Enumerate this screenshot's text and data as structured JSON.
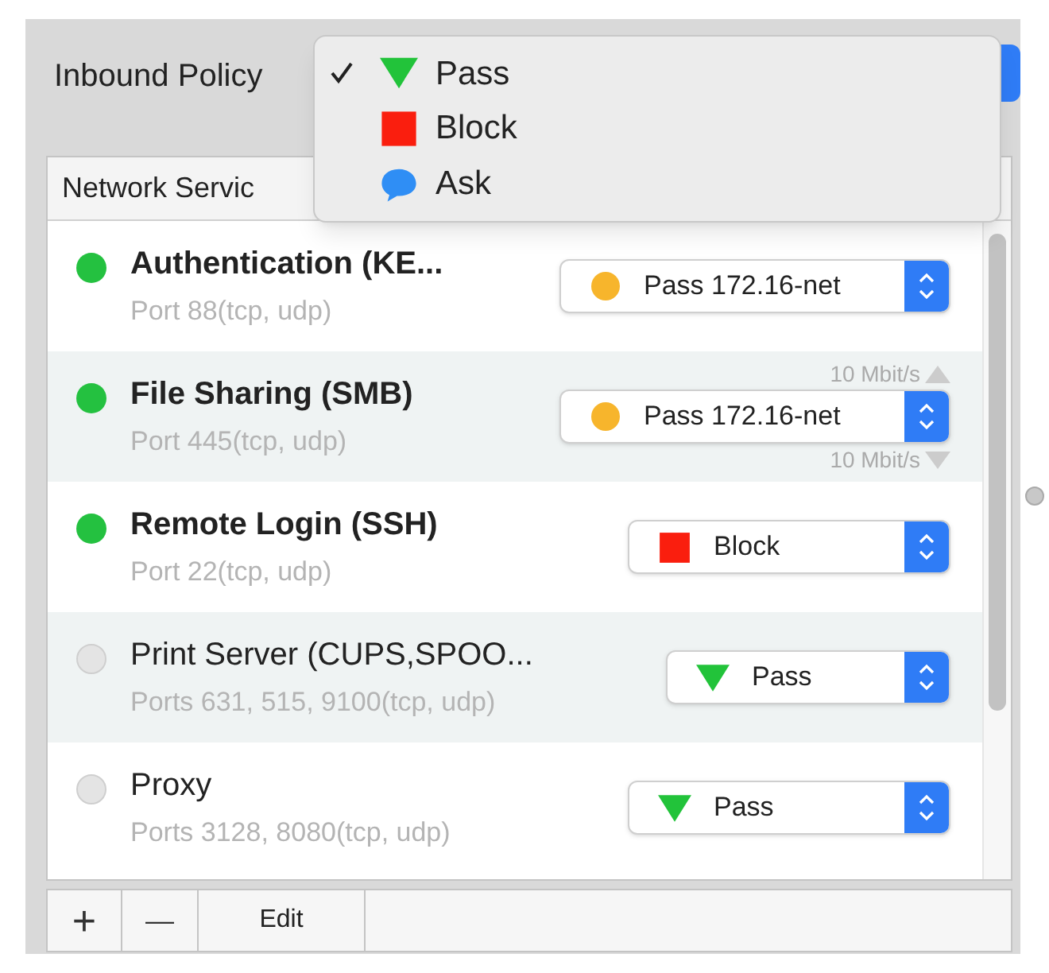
{
  "inbound_policy": {
    "label": "Inbound Policy",
    "menu": [
      {
        "kind": "pass",
        "label": "Pass",
        "selected": true
      },
      {
        "kind": "block",
        "label": "Block",
        "selected": false
      },
      {
        "kind": "ask",
        "label": "Ask",
        "selected": false
      }
    ]
  },
  "table": {
    "header": "Network Servic",
    "rows": [
      {
        "name": "Authentication (KE...",
        "ports": "Port 88(tcp, udp)",
        "active": true,
        "policy": {
          "kind": "net",
          "label": "Pass 172.16-net"
        }
      },
      {
        "name": "File Sharing (SMB)",
        "ports": "Port 445(tcp, udp)",
        "active": true,
        "policy": {
          "kind": "net",
          "label": "Pass 172.16-net"
        },
        "rate_up": "10 Mbit/s",
        "rate_down": "10 Mbit/s"
      },
      {
        "name": "Remote Login (SSH)",
        "ports": "Port 22(tcp, udp)",
        "active": true,
        "policy": {
          "kind": "block",
          "label": "Block"
        }
      },
      {
        "name": "Print Server (CUPS,SPOO...",
        "ports": "Ports 631, 515, 9100(tcp, udp)",
        "active": false,
        "policy": {
          "kind": "pass",
          "label": "Pass"
        }
      },
      {
        "name": "Proxy",
        "ports": "Ports 3128, 8080(tcp, udp)",
        "active": false,
        "policy": {
          "kind": "pass",
          "label": "Pass"
        }
      }
    ]
  },
  "toolbar": {
    "add": "+",
    "remove": "—",
    "edit": "Edit"
  }
}
